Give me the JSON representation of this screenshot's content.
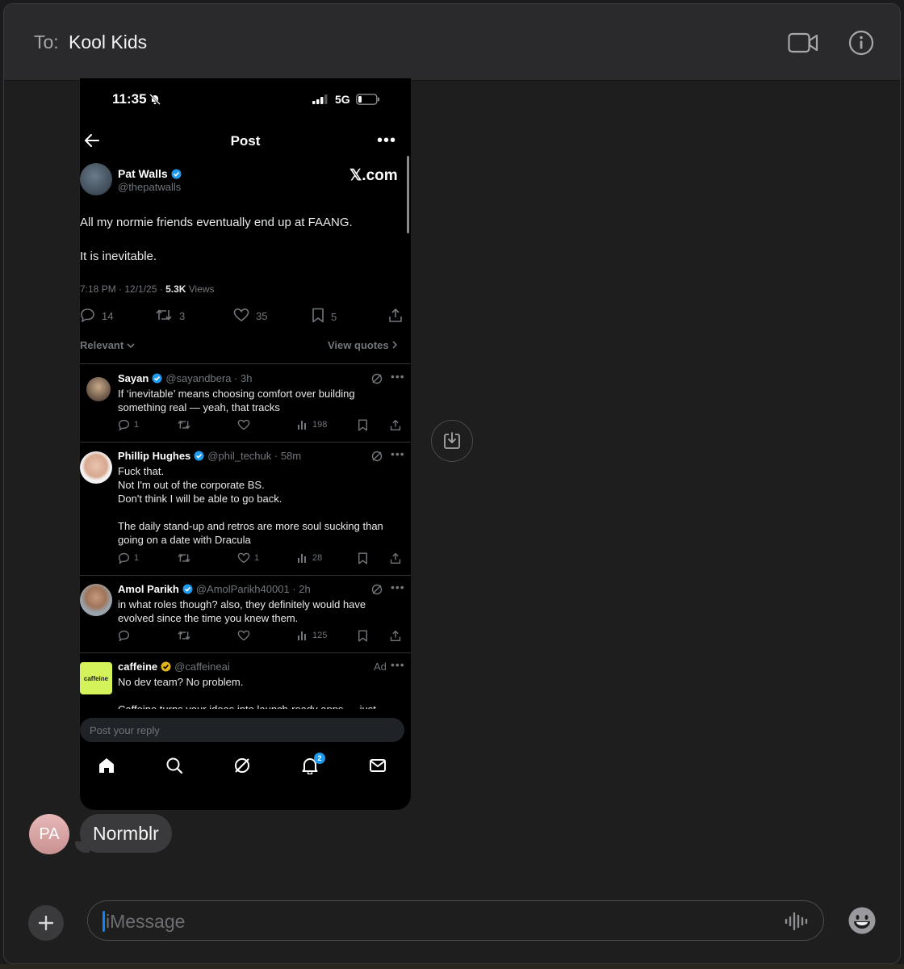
{
  "header": {
    "to_label": "To:",
    "recipient": "Kool Kids",
    "icons": [
      "video-icon",
      "info-icon"
    ]
  },
  "shared_screenshot": {
    "status_bar": {
      "time": "11:35",
      "network": "5G"
    },
    "nav": {
      "title": "Post"
    },
    "post": {
      "author": "Pat Walls",
      "handle": "@thepatwalls",
      "source": "𝕏.com",
      "text_line1": "All my normie friends eventually end up at FAANG.",
      "text_line2": "It is inevitable.",
      "meta_prefix": "7:18 PM · 12/1/25 · ",
      "views_count": "5.3K",
      "views_label": " Views",
      "replies": "14",
      "reposts": "3",
      "likes": "35",
      "bookmarks": "5"
    },
    "sort_label": "Relevant",
    "view_quotes": "View quotes",
    "replies": [
      {
        "name": "Sayan",
        "handle": "@sayandbera · 3h",
        "text": "If ‘inevitable’ means choosing comfort over building something real — yeah, that tracks",
        "replies": "1",
        "reposts": "",
        "likes": "",
        "views": "198"
      },
      {
        "name": "Phillip Hughes",
        "handle": "@phil_techuk · 58m",
        "text": "Fuck that.\nNot I'm out of the corporate BS.\nDon't think I will be able to go back.\n\nThe daily stand-up and retros are more soul sucking than going on a date with Dracula",
        "replies": "1",
        "reposts": "",
        "likes": "1",
        "views": "28"
      },
      {
        "name": "Amol Parikh",
        "handle": "@AmolParikh40001 · 2h",
        "text": "in what roles though? also, they definitely would have evolved since the time you knew them.",
        "replies": "",
        "reposts": "",
        "likes": "",
        "views": "125"
      }
    ],
    "ad": {
      "name": "caffeine",
      "handle": "@caffeineai",
      "tag": "Ad",
      "logo_text": "caffeine",
      "text": "No dev team? No problem.\n\nCaffeine turns your ideas into launch-ready apps — just"
    },
    "reply_placeholder": "Post your reply",
    "tabbar_badge": "2"
  },
  "message": {
    "sender_initials": "PA",
    "text": "Normblr"
  },
  "compose": {
    "placeholder": "iMessage"
  },
  "colors": {
    "accent": "#0a84ff",
    "x_blue": "#1d9bf0",
    "bubble": "#3a3a3c",
    "caffeine_logo_bg": "#d4f25a"
  }
}
